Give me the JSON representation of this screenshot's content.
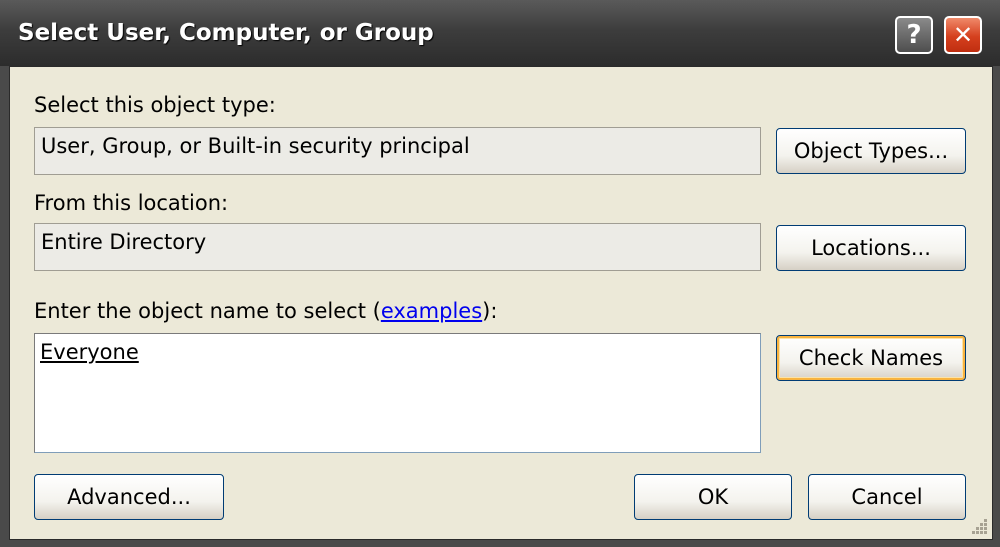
{
  "window": {
    "title": "Select User, Computer, or Group",
    "help_glyph": "?",
    "close_glyph": "✕"
  },
  "object_type": {
    "label": "Select this object type:",
    "value": "User, Group, or Built-in security principal",
    "button": "Object Types..."
  },
  "location": {
    "label": "From this location:",
    "value": "Entire Directory",
    "button": "Locations..."
  },
  "object_name": {
    "label_prefix": "Enter the object name to select (",
    "link": "examples",
    "label_suffix": "):",
    "value": "Everyone",
    "button": "Check Names"
  },
  "footer": {
    "advanced": "Advanced...",
    "ok": "OK",
    "cancel": "Cancel"
  },
  "colors": {
    "titlebar": "#3d3d3d",
    "client": "#ece9d8",
    "close": "#d5401e",
    "default_highlight": "#f8b33f",
    "link": "#0000ee"
  }
}
